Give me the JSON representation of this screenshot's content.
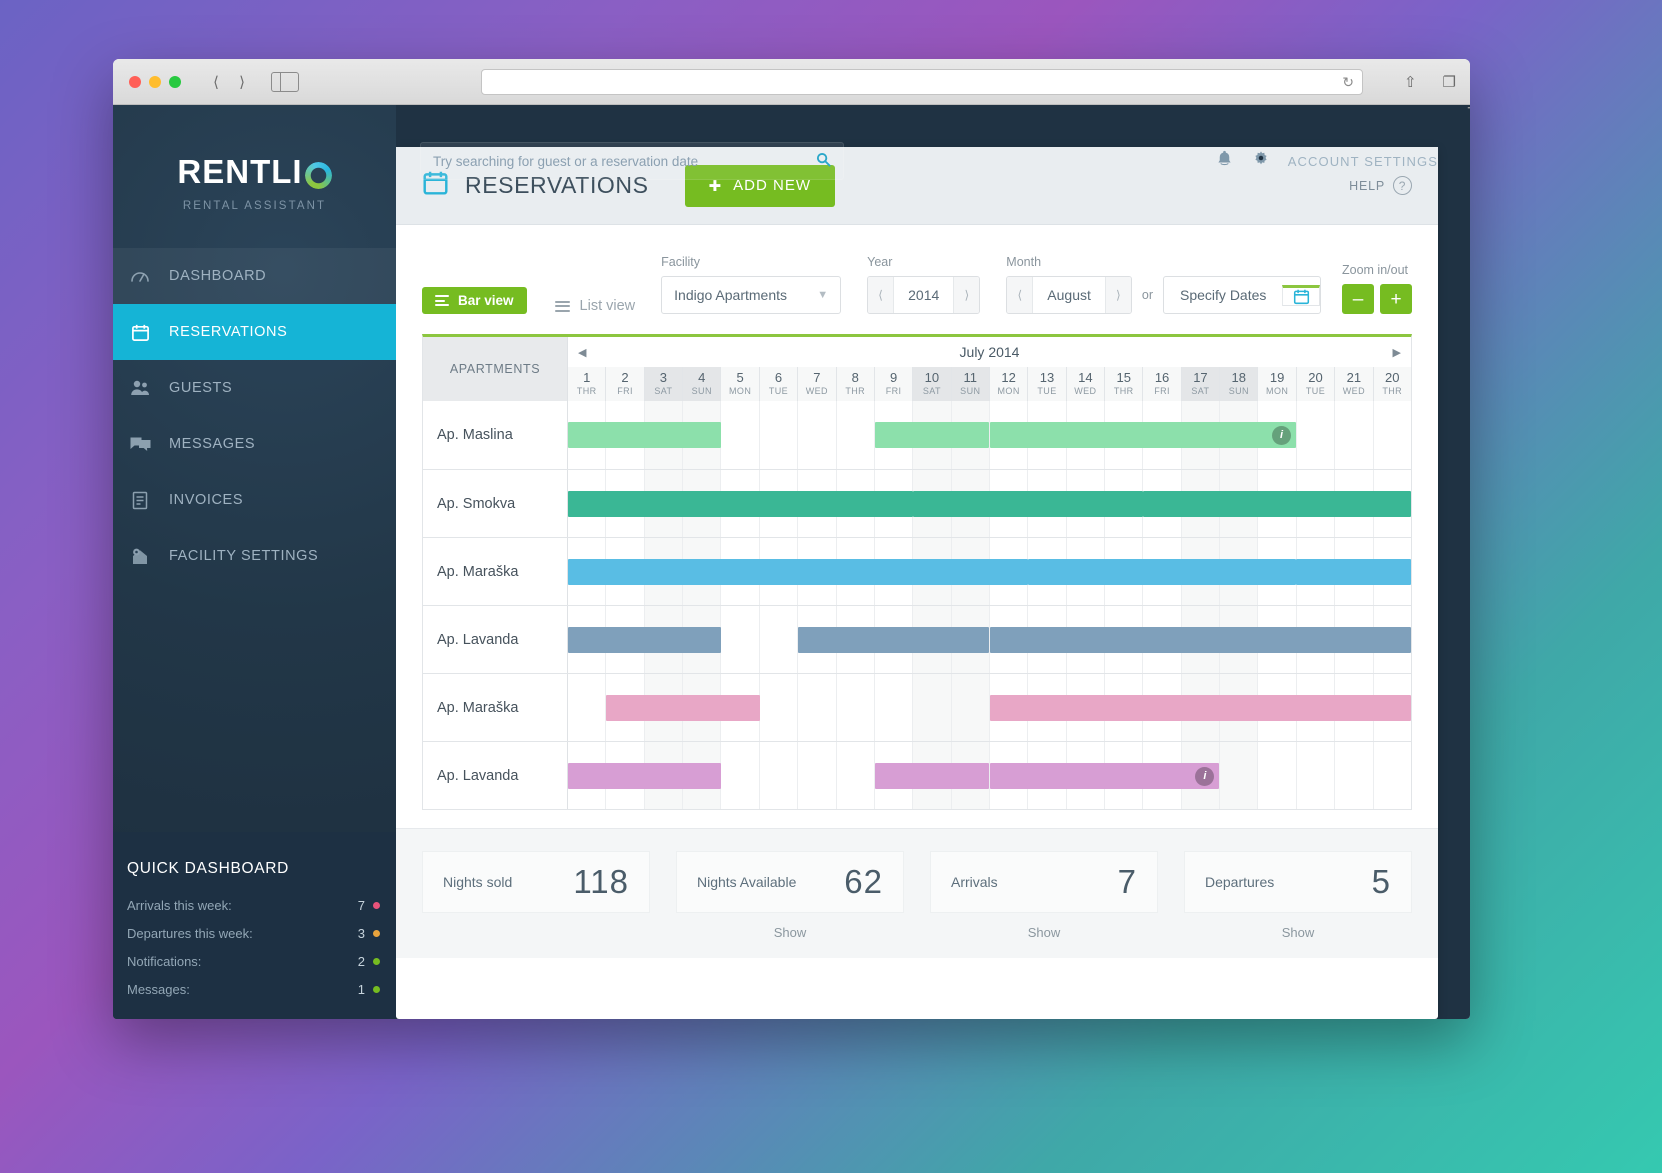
{
  "browser": {
    "url_value": "",
    "reload_icon": "reload-icon",
    "back_icon": "back-icon",
    "forward_icon": "forward-icon",
    "sidebar_icon": "sidebar-toggle-icon",
    "share_icon": "share-icon",
    "tabs_icon": "tabs-icon",
    "new_tab_icon": "new-tab-icon"
  },
  "brand": {
    "name": "RENTLI",
    "tagline": "RENTAL ASSISTANT"
  },
  "search": {
    "placeholder": "Try searching for guest or a reservation date",
    "value": "",
    "icon": "search-icon"
  },
  "header": {
    "bell_icon": "bell-icon",
    "gear_icon": "gear-icon",
    "account_label": "ACCOUNT SETTINGS"
  },
  "sidebar": {
    "items": [
      {
        "label": "DASHBOARD",
        "icon": "gauge-icon",
        "active": false
      },
      {
        "label": "RESERVATIONS",
        "icon": "calendar-icon",
        "active": true
      },
      {
        "label": "GUESTS",
        "icon": "users-icon",
        "active": false
      },
      {
        "label": "MESSAGES",
        "icon": "chat-icon",
        "active": false
      },
      {
        "label": "INVOICES",
        "icon": "document-icon",
        "active": false
      },
      {
        "label": "FACILITY SETTINGS",
        "icon": "house-gear-icon",
        "active": false
      }
    ],
    "quick_dashboard": {
      "title": "QUICK DASHBOARD",
      "rows": [
        {
          "label": "Arrivals this week:",
          "value": "7",
          "color": "#e8537a"
        },
        {
          "label": "Departures this week:",
          "value": "3",
          "color": "#e8a33d"
        },
        {
          "label": "Notifications:",
          "value": "2",
          "color": "#76bc21"
        },
        {
          "label": "Messages:",
          "value": "1",
          "color": "#76bc21"
        }
      ]
    }
  },
  "page": {
    "title": "RESERVATIONS",
    "calendar_icon": "calendar-icon",
    "add_new_label": "ADD NEW",
    "add_new_icon": "plus-icon",
    "help_label": "HELP",
    "help_icon": "question-circle-icon"
  },
  "toolbar": {
    "bar_view_label": "Bar view",
    "bar_view_icon": "bars-icon",
    "list_view_label": "List view",
    "list_view_icon": "list-icon",
    "facility_label": "Facility",
    "facility_value": "Indigo Apartments",
    "facility_chevron": "chevron-down-icon",
    "year_label": "Year",
    "year_value": "2014",
    "month_label": "Month",
    "month_value": "August",
    "or_label": "or",
    "specify_dates_label": "Specify Dates",
    "specify_dates_icon": "calendar-icon",
    "zoom_label": "Zoom in/out",
    "zoom_out_label": "–",
    "zoom_in_label": "+",
    "prev_icon": "chevron-left-icon",
    "next_icon": "chevron-right-icon"
  },
  "calendar": {
    "apartments_header": "APARTMENTS",
    "month_title": "July 2014",
    "prev_icon": "triangle-left-icon",
    "next_icon": "triangle-right-icon",
    "days": [
      {
        "n": "1",
        "d": "THR",
        "weekend": false
      },
      {
        "n": "2",
        "d": "FRI",
        "weekend": false
      },
      {
        "n": "3",
        "d": "SAT",
        "weekend": true
      },
      {
        "n": "4",
        "d": "SUN",
        "weekend": true
      },
      {
        "n": "5",
        "d": "MON",
        "weekend": false
      },
      {
        "n": "6",
        "d": "TUE",
        "weekend": false
      },
      {
        "n": "7",
        "d": "WED",
        "weekend": false
      },
      {
        "n": "8",
        "d": "THR",
        "weekend": false
      },
      {
        "n": "9",
        "d": "FRI",
        "weekend": false
      },
      {
        "n": "10",
        "d": "SAT",
        "weekend": true
      },
      {
        "n": "11",
        "d": "SUN",
        "weekend": true
      },
      {
        "n": "12",
        "d": "MON",
        "weekend": false
      },
      {
        "n": "13",
        "d": "TUE",
        "weekend": false
      },
      {
        "n": "14",
        "d": "WED",
        "weekend": false
      },
      {
        "n": "15",
        "d": "THR",
        "weekend": false
      },
      {
        "n": "16",
        "d": "FRI",
        "weekend": false
      },
      {
        "n": "17",
        "d": "SAT",
        "weekend": true
      },
      {
        "n": "18",
        "d": "SUN",
        "weekend": true
      },
      {
        "n": "19",
        "d": "MON",
        "weekend": false
      },
      {
        "n": "20",
        "d": "TUE",
        "weekend": false
      },
      {
        "n": "21",
        "d": "WED",
        "weekend": false
      },
      {
        "n": "20",
        "d": "THR",
        "weekend": false
      }
    ],
    "rows": [
      {
        "apartment": "Ap. Maslina",
        "color": "#8ce0ab",
        "bars": [
          {
            "start": 0,
            "end": 4,
            "badge": false
          },
          {
            "start": 8,
            "end": 11,
            "badge": false
          },
          {
            "start": 11,
            "end": 19,
            "badge": true
          }
        ]
      },
      {
        "apartment": "Ap. Smokva",
        "color": "#3ab795",
        "bars": [
          {
            "start": 0,
            "end": 9,
            "badge": false
          },
          {
            "start": 9,
            "end": 15,
            "badge": false
          },
          {
            "start": 15,
            "end": 22,
            "badge": false
          }
        ]
      },
      {
        "apartment": "Ap. Maraška",
        "color": "#59bde4",
        "bars": [
          {
            "start": 0,
            "end": 12,
            "badge": false
          },
          {
            "start": 12,
            "end": 19,
            "badge": false
          },
          {
            "start": 19,
            "end": 22,
            "badge": false
          }
        ]
      },
      {
        "apartment": "Ap. Lavanda",
        "color": "#7fa0bb",
        "bars": [
          {
            "start": 0,
            "end": 4,
            "badge": false
          },
          {
            "start": 6,
            "end": 11,
            "badge": false
          },
          {
            "start": 11,
            "end": 22,
            "badge": false
          }
        ]
      },
      {
        "apartment": "Ap. Maraška",
        "color": "#e8a7c6",
        "bars": [
          {
            "start": 1,
            "end": 5,
            "badge": false
          },
          {
            "start": 11,
            "end": 22,
            "badge": false
          }
        ]
      },
      {
        "apartment": "Ap. Lavanda",
        "color": "#d79ed4",
        "bars": [
          {
            "start": 0,
            "end": 4,
            "badge": false
          },
          {
            "start": 8,
            "end": 11,
            "badge": false
          },
          {
            "start": 11,
            "end": 17,
            "badge": true
          }
        ]
      }
    ]
  },
  "stats": [
    {
      "title": "Nights sold",
      "value": "118",
      "show": "",
      "has_show": false
    },
    {
      "title": "Nights Available",
      "value": "62",
      "show": "Show",
      "has_show": true
    },
    {
      "title": "Arrivals",
      "value": "7",
      "show": "Show",
      "has_show": true
    },
    {
      "title": "Departures",
      "value": "5",
      "show": "Show",
      "has_show": true
    }
  ],
  "colors": {
    "accent_green": "#76bc21",
    "accent_blue": "#15b4d6",
    "sidebar_dark": "#1d3043"
  }
}
